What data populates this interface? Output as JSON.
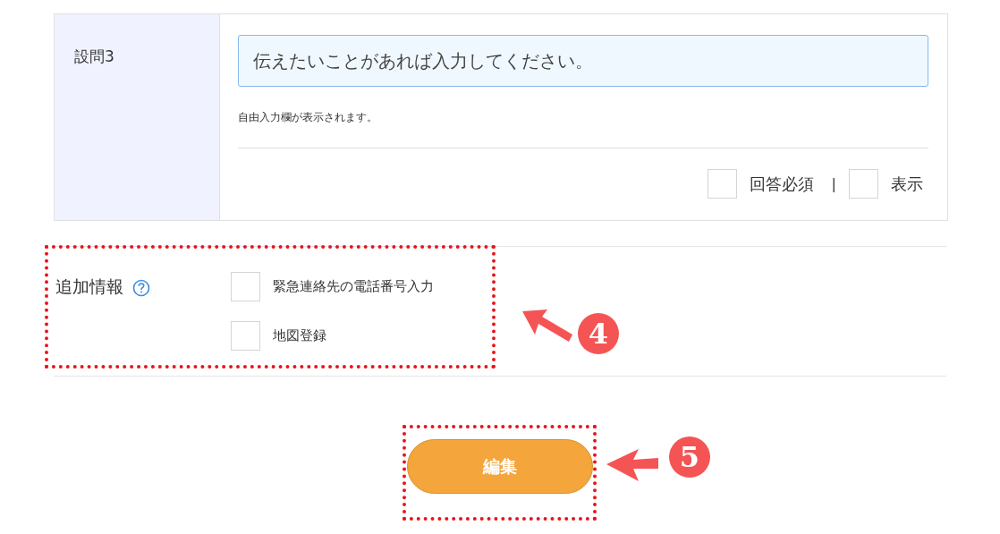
{
  "question": {
    "label": "設問3",
    "input": {
      "value": "伝えたいことがあれば入力してください。"
    },
    "hint": "自由入力欄が表示されます。",
    "options": [
      {
        "label": "回答必須",
        "checked": false
      },
      {
        "label": "表示",
        "checked": false
      }
    ],
    "separator": "|"
  },
  "additional_info": {
    "label": "追加情報",
    "options": [
      {
        "label": "緊急連絡先の電話番号入力",
        "checked": false
      },
      {
        "label": "地図登録",
        "checked": false
      }
    ]
  },
  "edit_button": {
    "label": "編集"
  },
  "annotations": [
    {
      "number": "4"
    },
    {
      "number": "5"
    }
  ]
}
